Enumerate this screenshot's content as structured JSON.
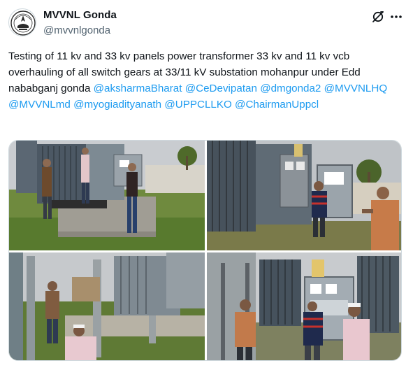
{
  "account": {
    "display_name": "MVVNL Gonda",
    "handle": "@mvvnlgonda",
    "avatar_icon": "mvvnl-emblem-icon"
  },
  "header_actions": {
    "grok_icon": "grok-icon",
    "more_icon": "more-horizontal-icon"
  },
  "tweet": {
    "body": "Testing of 11 kv and 33 kv panels power transformer 33 kv and 11 kv vcb overhauling of all switch gears at 33/11 kV substation mohanpur under Edd nababganj gonda ",
    "mentions": [
      "@aksharmaBharat",
      "@CeDevipatan",
      "@dmgonda2",
      "@MVVNLHQ",
      "@MVVNLmd",
      "@myogiadityanath",
      "@UPPCLLKO",
      "@ChairmanUppcl"
    ]
  },
  "media": {
    "photos": [
      {
        "name": "photo-1",
        "description_icon": "transformer-photo"
      },
      {
        "name": "photo-2",
        "description_icon": "transformer-photo"
      },
      {
        "name": "photo-3",
        "description_icon": "transformer-photo"
      },
      {
        "name": "photo-4",
        "description_icon": "transformer-photo"
      }
    ]
  },
  "colors": {
    "mention": "#1d9bf0",
    "secondary_text": "#536471",
    "border": "#cfd9de"
  }
}
